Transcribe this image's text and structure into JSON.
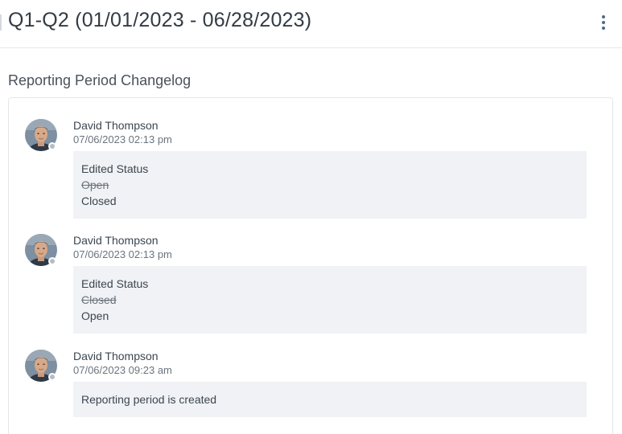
{
  "header": {
    "title": "Q1-Q2 (01/01/2023 - 06/28/2023)",
    "menu_icon": "kebab-menu-icon"
  },
  "changelog": {
    "title": "Reporting Period Changelog",
    "entries": [
      {
        "author": "David Thompson",
        "timestamp": "07/06/2023 02:13 pm",
        "action": "Edited Status",
        "old_value": "Open",
        "new_value": "Closed"
      },
      {
        "author": "David Thompson",
        "timestamp": "07/06/2023 02:13 pm",
        "action": "Edited Status",
        "old_value": "Closed",
        "new_value": "Open"
      },
      {
        "author": "David Thompson",
        "timestamp": "07/06/2023 09:23 am",
        "action": "Reporting period is created"
      }
    ]
  },
  "colors": {
    "accent": "#4f6b84",
    "box_background": "#f0f2f5",
    "presence_offline": "#b7bcc2"
  }
}
